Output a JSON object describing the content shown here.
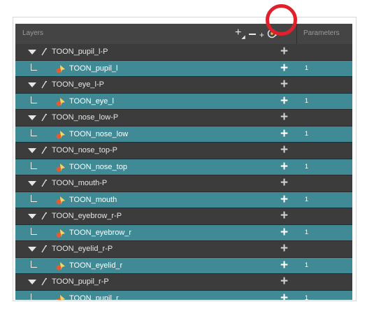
{
  "header": {
    "title": "Layers",
    "parameters_label": "Parameters",
    "add_layer_label": "+",
    "add_layer_sub": "◢",
    "add_peg_label": "+"
  },
  "colors": {
    "child_row": "#3f8a95",
    "parent_row": "#3c3c3c",
    "highlight": "#e0202b"
  },
  "icons": {
    "peg": "peg-icon",
    "drawing": "drawing-layer-icon",
    "add_peg": "add-peg-icon"
  },
  "layers": [
    {
      "name": "TOON_pupil_l-P",
      "type": "peg",
      "plus": "+"
    },
    {
      "name": "TOON_pupil_l",
      "type": "drawing",
      "plus": "+",
      "param": "1"
    },
    {
      "name": "TOON_eye_l-P",
      "type": "peg",
      "plus": "+"
    },
    {
      "name": "TOON_eye_l",
      "type": "drawing",
      "plus": "+",
      "param": "1"
    },
    {
      "name": "TOON_nose_low-P",
      "type": "peg",
      "plus": "+"
    },
    {
      "name": "TOON_nose_low",
      "type": "drawing",
      "plus": "+",
      "param": "1"
    },
    {
      "name": "TOON_nose_top-P",
      "type": "peg",
      "plus": "+"
    },
    {
      "name": "TOON_nose_top",
      "type": "drawing",
      "plus": "+",
      "param": "1"
    },
    {
      "name": "TOON_mouth-P",
      "type": "peg",
      "plus": "+"
    },
    {
      "name": "TOON_mouth",
      "type": "drawing",
      "plus": "+",
      "param": "1"
    },
    {
      "name": "TOON_eyebrow_r-P",
      "type": "peg",
      "plus": "+"
    },
    {
      "name": "TOON_eyebrow_r",
      "type": "drawing",
      "plus": "+",
      "param": "1"
    },
    {
      "name": "TOON_eyelid_r-P",
      "type": "peg",
      "plus": "+"
    },
    {
      "name": "TOON_eyelid_r",
      "type": "drawing",
      "plus": "+",
      "param": "1"
    },
    {
      "name": "TOON_pupil_r-P",
      "type": "peg",
      "plus": "+"
    },
    {
      "name": "TOON_pupil_r",
      "type": "drawing",
      "plus": "+",
      "param": "1"
    }
  ]
}
